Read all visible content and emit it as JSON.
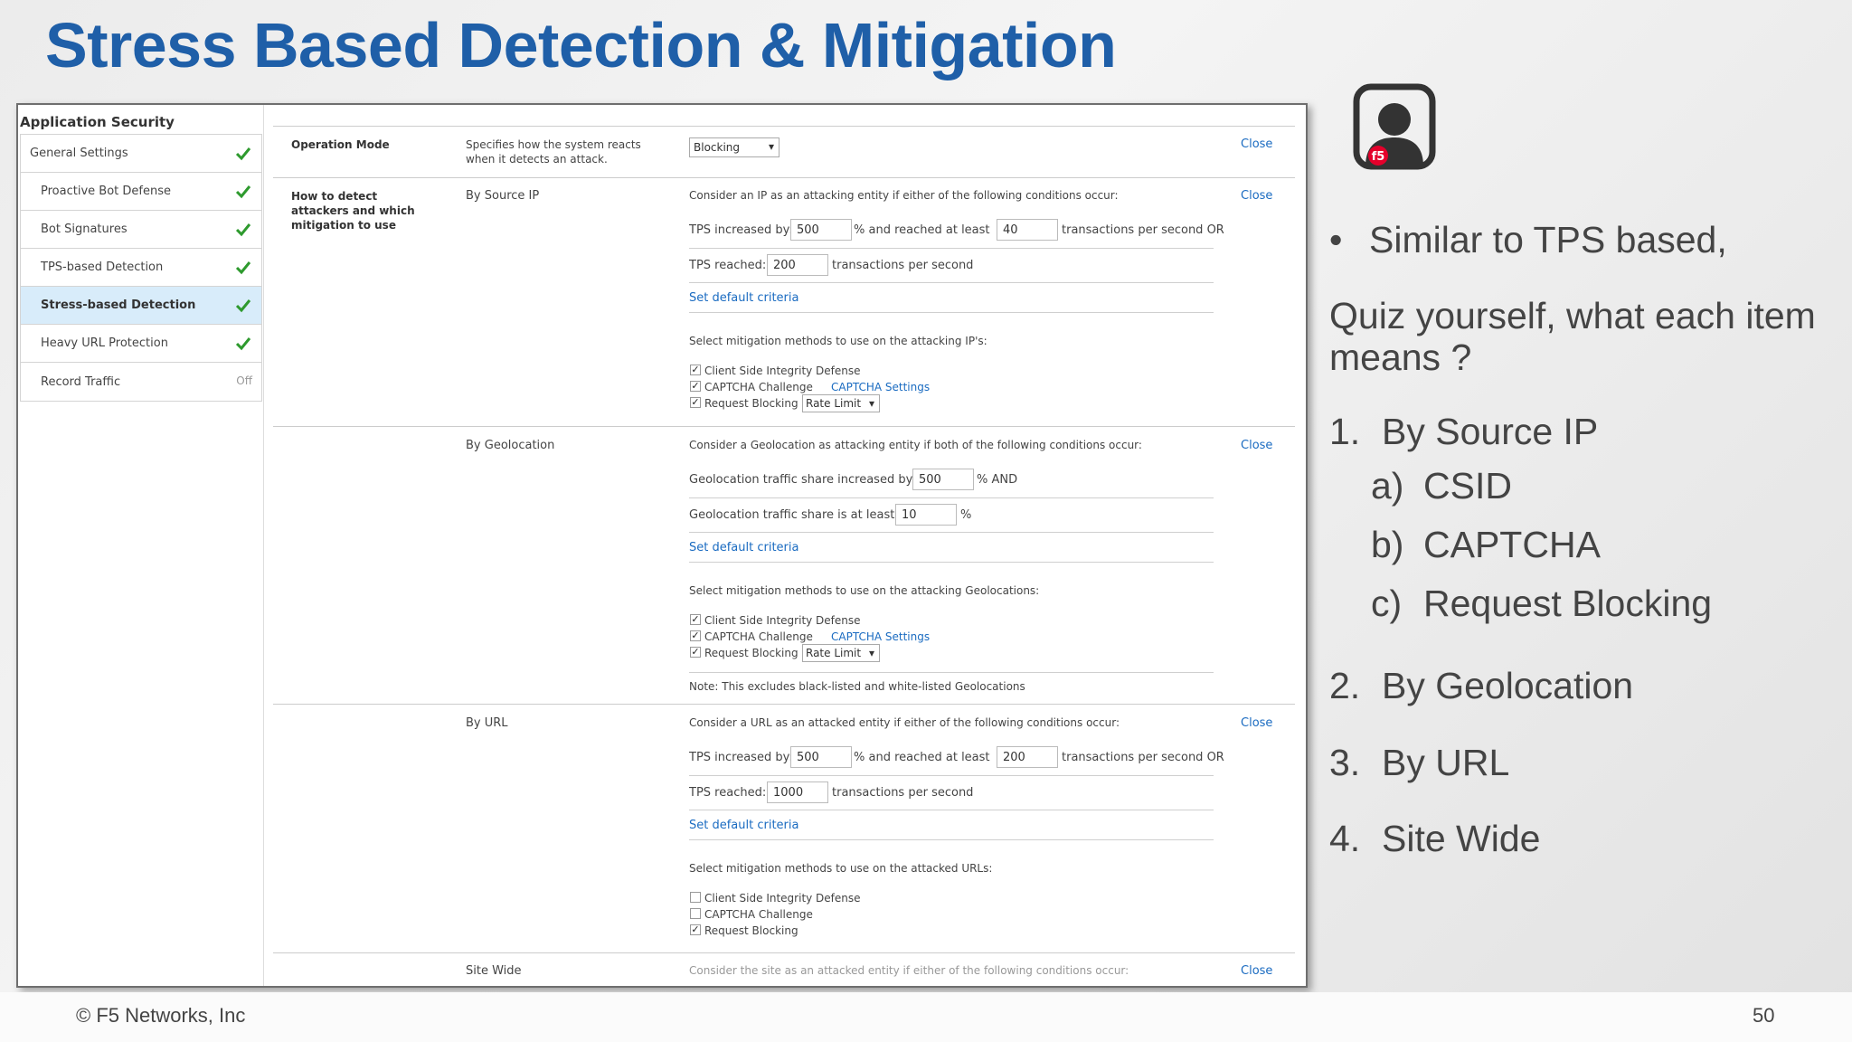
{
  "slide": {
    "title": "Stress Based Detection & Mitigation",
    "copyright": "© F5 Networks, Inc",
    "page_number": "50"
  },
  "sidebar": {
    "title": "Application Security",
    "items": [
      {
        "label": "General Settings",
        "status": "check"
      },
      {
        "label": "Proactive Bot Defense",
        "status": "check"
      },
      {
        "label": "Bot Signatures",
        "status": "check"
      },
      {
        "label": "TPS-based Detection",
        "status": "check"
      },
      {
        "label": "Stress-based Detection",
        "status": "check"
      },
      {
        "label": "Heavy URL Protection",
        "status": "check"
      },
      {
        "label": "Record Traffic",
        "status": "Off"
      }
    ]
  },
  "operation_mode": {
    "label": "Operation Mode",
    "description": "Specifies how the system reacts when it detects an attack.",
    "value": "Blocking",
    "close": "Close"
  },
  "detect_label": "How to detect attackers and which mitigation to use",
  "source_ip": {
    "label": "By Source IP",
    "intro": "Consider an IP as an attacking entity if either of the following conditions occur:",
    "close": "Close",
    "tps_increased_label": "TPS increased by:",
    "tps_increased_value": "500",
    "reached_least_label": "% and reached at least",
    "reached_least_value": "40",
    "tps_or_label": "transactions per second OR",
    "tps_reached_label": "TPS reached:",
    "tps_reached_value": "200",
    "tps_reached_suffix": "transactions per second",
    "set_default": "Set default criteria",
    "mitigation_intro": "Select mitigation methods to use on the attacking IP's:",
    "csid": "Client Side Integrity Defense",
    "captcha": "CAPTCHA Challenge",
    "captcha_settings": "CAPTCHA Settings",
    "request_blocking": "Request Blocking",
    "rate_limit": "Rate Limit"
  },
  "geolocation": {
    "label": "By Geolocation",
    "intro": "Consider a Geolocation as attacking entity if both of the following conditions occur:",
    "close": "Close",
    "share_increased_label": "Geolocation traffic share increased by:",
    "share_increased_value": "500",
    "and_label": "% AND",
    "share_least_label": "Geolocation traffic share is at least:",
    "share_least_value": "10",
    "percent": "%",
    "set_default": "Set default criteria",
    "mitigation_intro": "Select mitigation methods to use on the attacking Geolocations:",
    "csid": "Client Side Integrity Defense",
    "captcha": "CAPTCHA Challenge",
    "captcha_settings": "CAPTCHA Settings",
    "request_blocking": "Request Blocking",
    "rate_limit": "Rate Limit",
    "note": "Note: This excludes black-listed and white-listed Geolocations"
  },
  "url": {
    "label": "By URL",
    "intro": "Consider a URL as an attacked entity if either of the following conditions occur:",
    "close": "Close",
    "tps_increased_label": "TPS increased by:",
    "tps_increased_value": "500",
    "reached_least_label": "% and reached at least",
    "reached_least_value": "200",
    "tps_or_label": "transactions per second OR",
    "tps_reached_label": "TPS reached:",
    "tps_reached_value": "1000",
    "tps_reached_suffix": "transactions per second",
    "set_default": "Set default criteria",
    "mitigation_intro": "Select mitigation methods to use on the attacked URLs:",
    "csid": "Client Side Integrity Defense",
    "captcha": "CAPTCHA Challenge",
    "request_blocking": "Request Blocking"
  },
  "site_wide": {
    "label": "Site Wide",
    "intro": "Consider the site as an attacked entity if either of the following conditions occur:",
    "close": "Close"
  },
  "notes": {
    "bullet": "Similar to TPS based,",
    "quiz_line1": "Quiz yourself, what each item",
    "quiz_line2": "means ?",
    "items": [
      {
        "num": "1.",
        "text": "By Source IP"
      },
      {
        "num": "a)",
        "text": "CSID"
      },
      {
        "num": "b)",
        "text": "CAPTCHA"
      },
      {
        "num": "c)",
        "text": "Request Blocking"
      },
      {
        "num": "2.",
        "text": "By Geolocation"
      },
      {
        "num": "3.",
        "text": "By URL"
      },
      {
        "num": "4.",
        "text": "Site Wide"
      }
    ]
  },
  "colors": {
    "title_blue": "#1f5fa8",
    "link_blue": "#1a6bc1",
    "check_green": "#2e9a2e",
    "active_row": "#d8ecfa",
    "f5_red": "#e4002b"
  }
}
